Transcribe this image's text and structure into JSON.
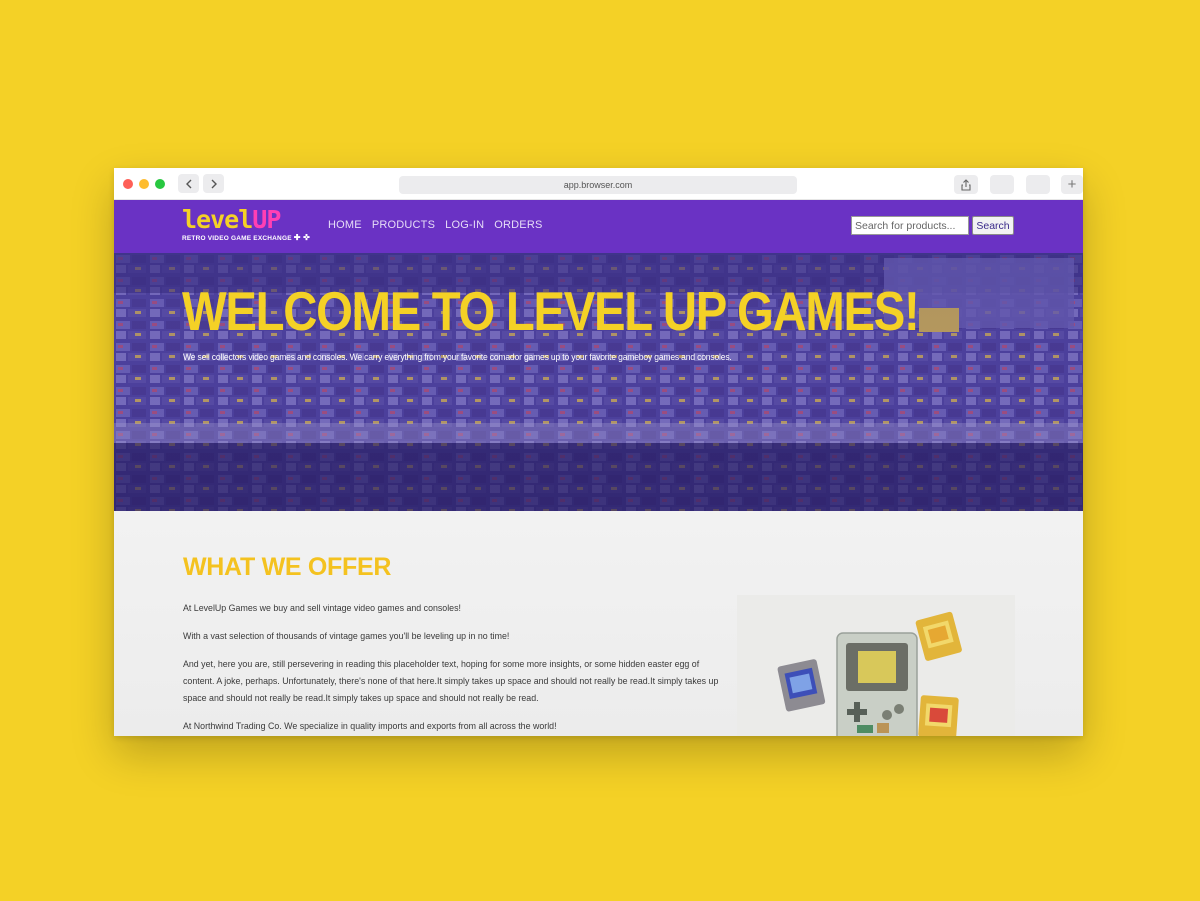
{
  "browser": {
    "url": "app.browser.com",
    "controls": {
      "back_icon": "chevron-left-icon",
      "forward_icon": "chevron-right-icon",
      "share_icon": "share-icon",
      "new_tab": "+"
    }
  },
  "site": {
    "logo": {
      "word_level": "level",
      "word_up": "UP",
      "tagline": "RETRO VIDEO GAME EXCHANGE",
      "tagline_icons": "✚ ✜"
    },
    "nav": {
      "items": [
        "HOME",
        "PRODUCTS",
        "LOG-IN",
        "ORDERS"
      ]
    },
    "search": {
      "placeholder": "Search for products...",
      "button": "Search"
    }
  },
  "hero": {
    "title": "WELCOME TO LEVEL UP GAMES!",
    "text": "We sell collectors video games and consoles. We carry everything from your favorite comador games up to your favorite gameboy games and consoles."
  },
  "offer": {
    "title": "WHAT WE OFFER",
    "paragraphs": [
      "At LevelUp Games we buy and sell vintage video games and consoles!",
      "With a vast selection of thousands of vintage games you'll be leveling up in no time!",
      "And yet, here you are, still persevering in reading this placeholder text, hoping for some more insights, or some hidden easter egg of content. A joke, perhaps. Unfortunately, there's none of that here.It simply takes up space and should not really be read.It simply takes up space and should not really be read.It simply takes up space and should not really be read.",
      "At Northwind Trading Co. We specialize in quality imports and exports from all across the world!"
    ]
  },
  "colors": {
    "page_background": "#f4d126",
    "nav_purple": "#6a32c4",
    "accent_yellow": "#f4d126",
    "accent_pink": "#ff3fb4"
  }
}
